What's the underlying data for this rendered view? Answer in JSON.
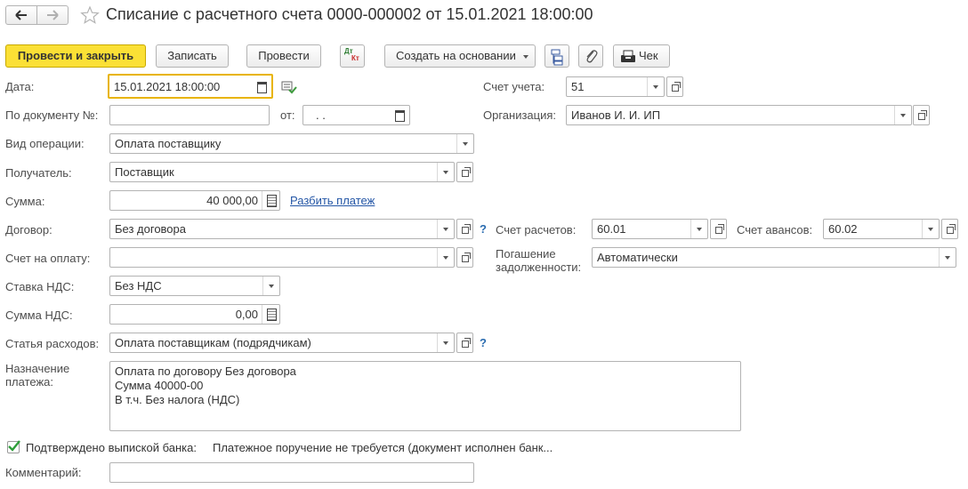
{
  "title": "Списание с расчетного счета 0000-000002 от 15.01.2021 18:00:00",
  "toolbar": {
    "post_close": "Провести и закрыть",
    "save": "Записать",
    "post": "Провести",
    "dtkt_dt": "Дт",
    "dtkt_kt": "Кт",
    "create_based": "Создать на основании",
    "receipt": "Чек"
  },
  "form": {
    "date_label": "Дата:",
    "date_value": "15.01.2021 18:00:00",
    "docnum_label": "По документу №:",
    "docnum_value": "",
    "from_label": "от:",
    "from_value": " .  .",
    "account_label": "Счет учета:",
    "account_value": "51",
    "org_label": "Организация:",
    "org_value": "Иванов И. И. ИП",
    "optype_label": "Вид операции:",
    "optype_value": "Оплата поставщику",
    "recipient_label": "Получатель:",
    "recipient_value": "Поставщик",
    "sum_label": "Сумма:",
    "sum_value": "40 000,00",
    "split_link": "Разбить платеж",
    "contract_label": "Договор:",
    "contract_value": "Без договора",
    "settle_label": "Счет расчетов:",
    "settle_value": "60.01",
    "advance_label": "Счет авансов:",
    "advance_value": "60.02",
    "invoice_label": "Счет на оплату:",
    "invoice_value": "",
    "debt_label_1": "Погашение",
    "debt_label_2": "задолженности:",
    "debt_value": "Автоматически",
    "vat_rate_label": "Ставка НДС:",
    "vat_rate_value": "Без НДС",
    "vat_sum_label": "Сумма НДС:",
    "vat_sum_value": "0,00",
    "expense_label": "Статья расходов:",
    "expense_value": "Оплата поставщикам (подрядчикам)",
    "purpose_label_1": "Назначение",
    "purpose_label_2": "платежа:",
    "purpose_line1": "Оплата по договору Без договора",
    "purpose_line2": "Сумма 40000-00",
    "purpose_line3": "В т.ч. Без налога (НДС)",
    "confirmed_label": "Подтверждено выпиской банка:",
    "confirmed_checked": true,
    "payment_order_text": "Платежное поручение не требуется (документ исполнен банк...",
    "comment_label": "Комментарий:",
    "comment_value": "",
    "help": "?"
  },
  "colors": {
    "primary_button": "#fbe035",
    "link": "#2456a6",
    "focus_border": "#e8b400",
    "help": "#2b6cb0"
  }
}
